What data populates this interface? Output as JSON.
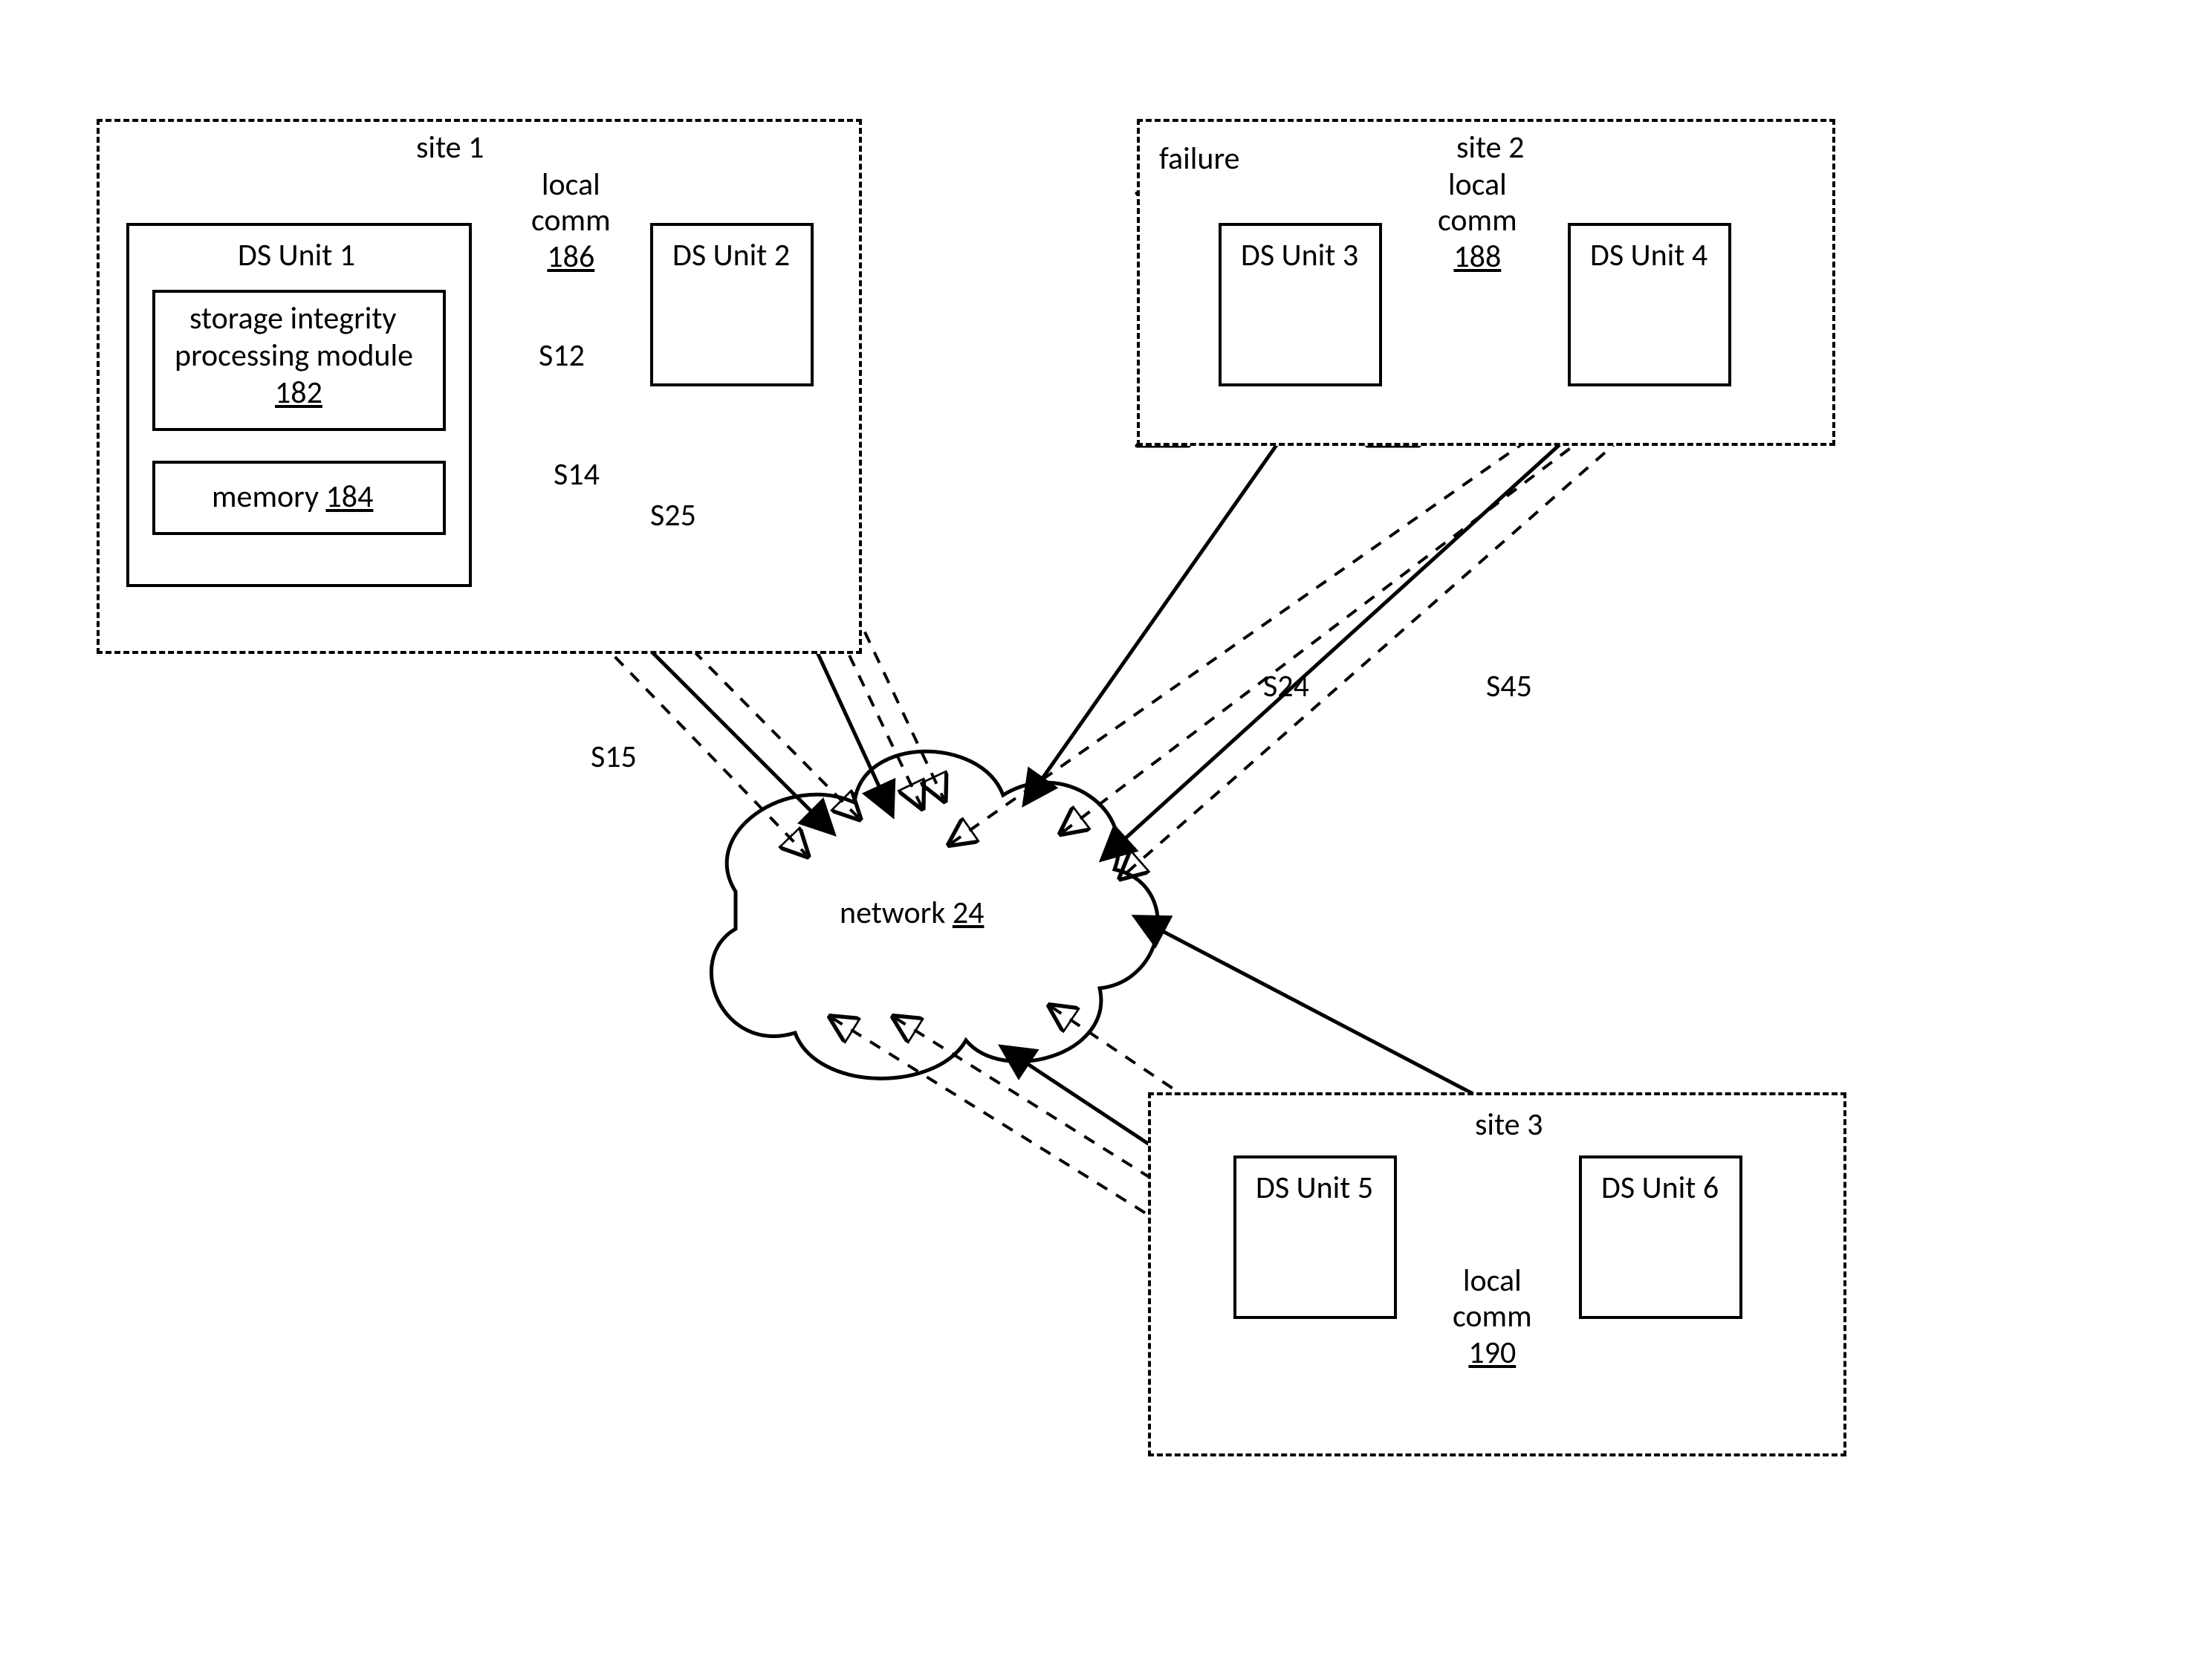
{
  "sites": {
    "site1": {
      "title": "site 1"
    },
    "site2": {
      "title": "site 2",
      "failure_label": "failure"
    },
    "site3": {
      "title": "site 3"
    }
  },
  "ds_units": {
    "u1": {
      "title": "DS Unit 1",
      "module_line1": "storage integrity",
      "module_line2": "processing module",
      "module_ref": "182",
      "memory_prefix": "memory ",
      "memory_ref": "184"
    },
    "u2": {
      "title": "DS Unit 2"
    },
    "u3": {
      "title": "DS Unit 3"
    },
    "u4": {
      "title": "DS Unit 4"
    },
    "u5": {
      "title": "DS Unit 5"
    },
    "u6": {
      "title": "DS Unit 6"
    }
  },
  "local_comm": {
    "site1": {
      "line1": "local",
      "line2": "comm",
      "ref": "186"
    },
    "site2": {
      "line1": "local",
      "line2": "comm",
      "ref": "188"
    },
    "site3": {
      "line1": "local",
      "line2": "comm",
      "ref": "190"
    }
  },
  "network": {
    "prefix": "network ",
    "ref": "24"
  },
  "slice_paths": {
    "S12": "S12",
    "S14": "S14",
    "S15": "S15",
    "S24": "S24",
    "S25": "S25",
    "S45": "S45"
  }
}
